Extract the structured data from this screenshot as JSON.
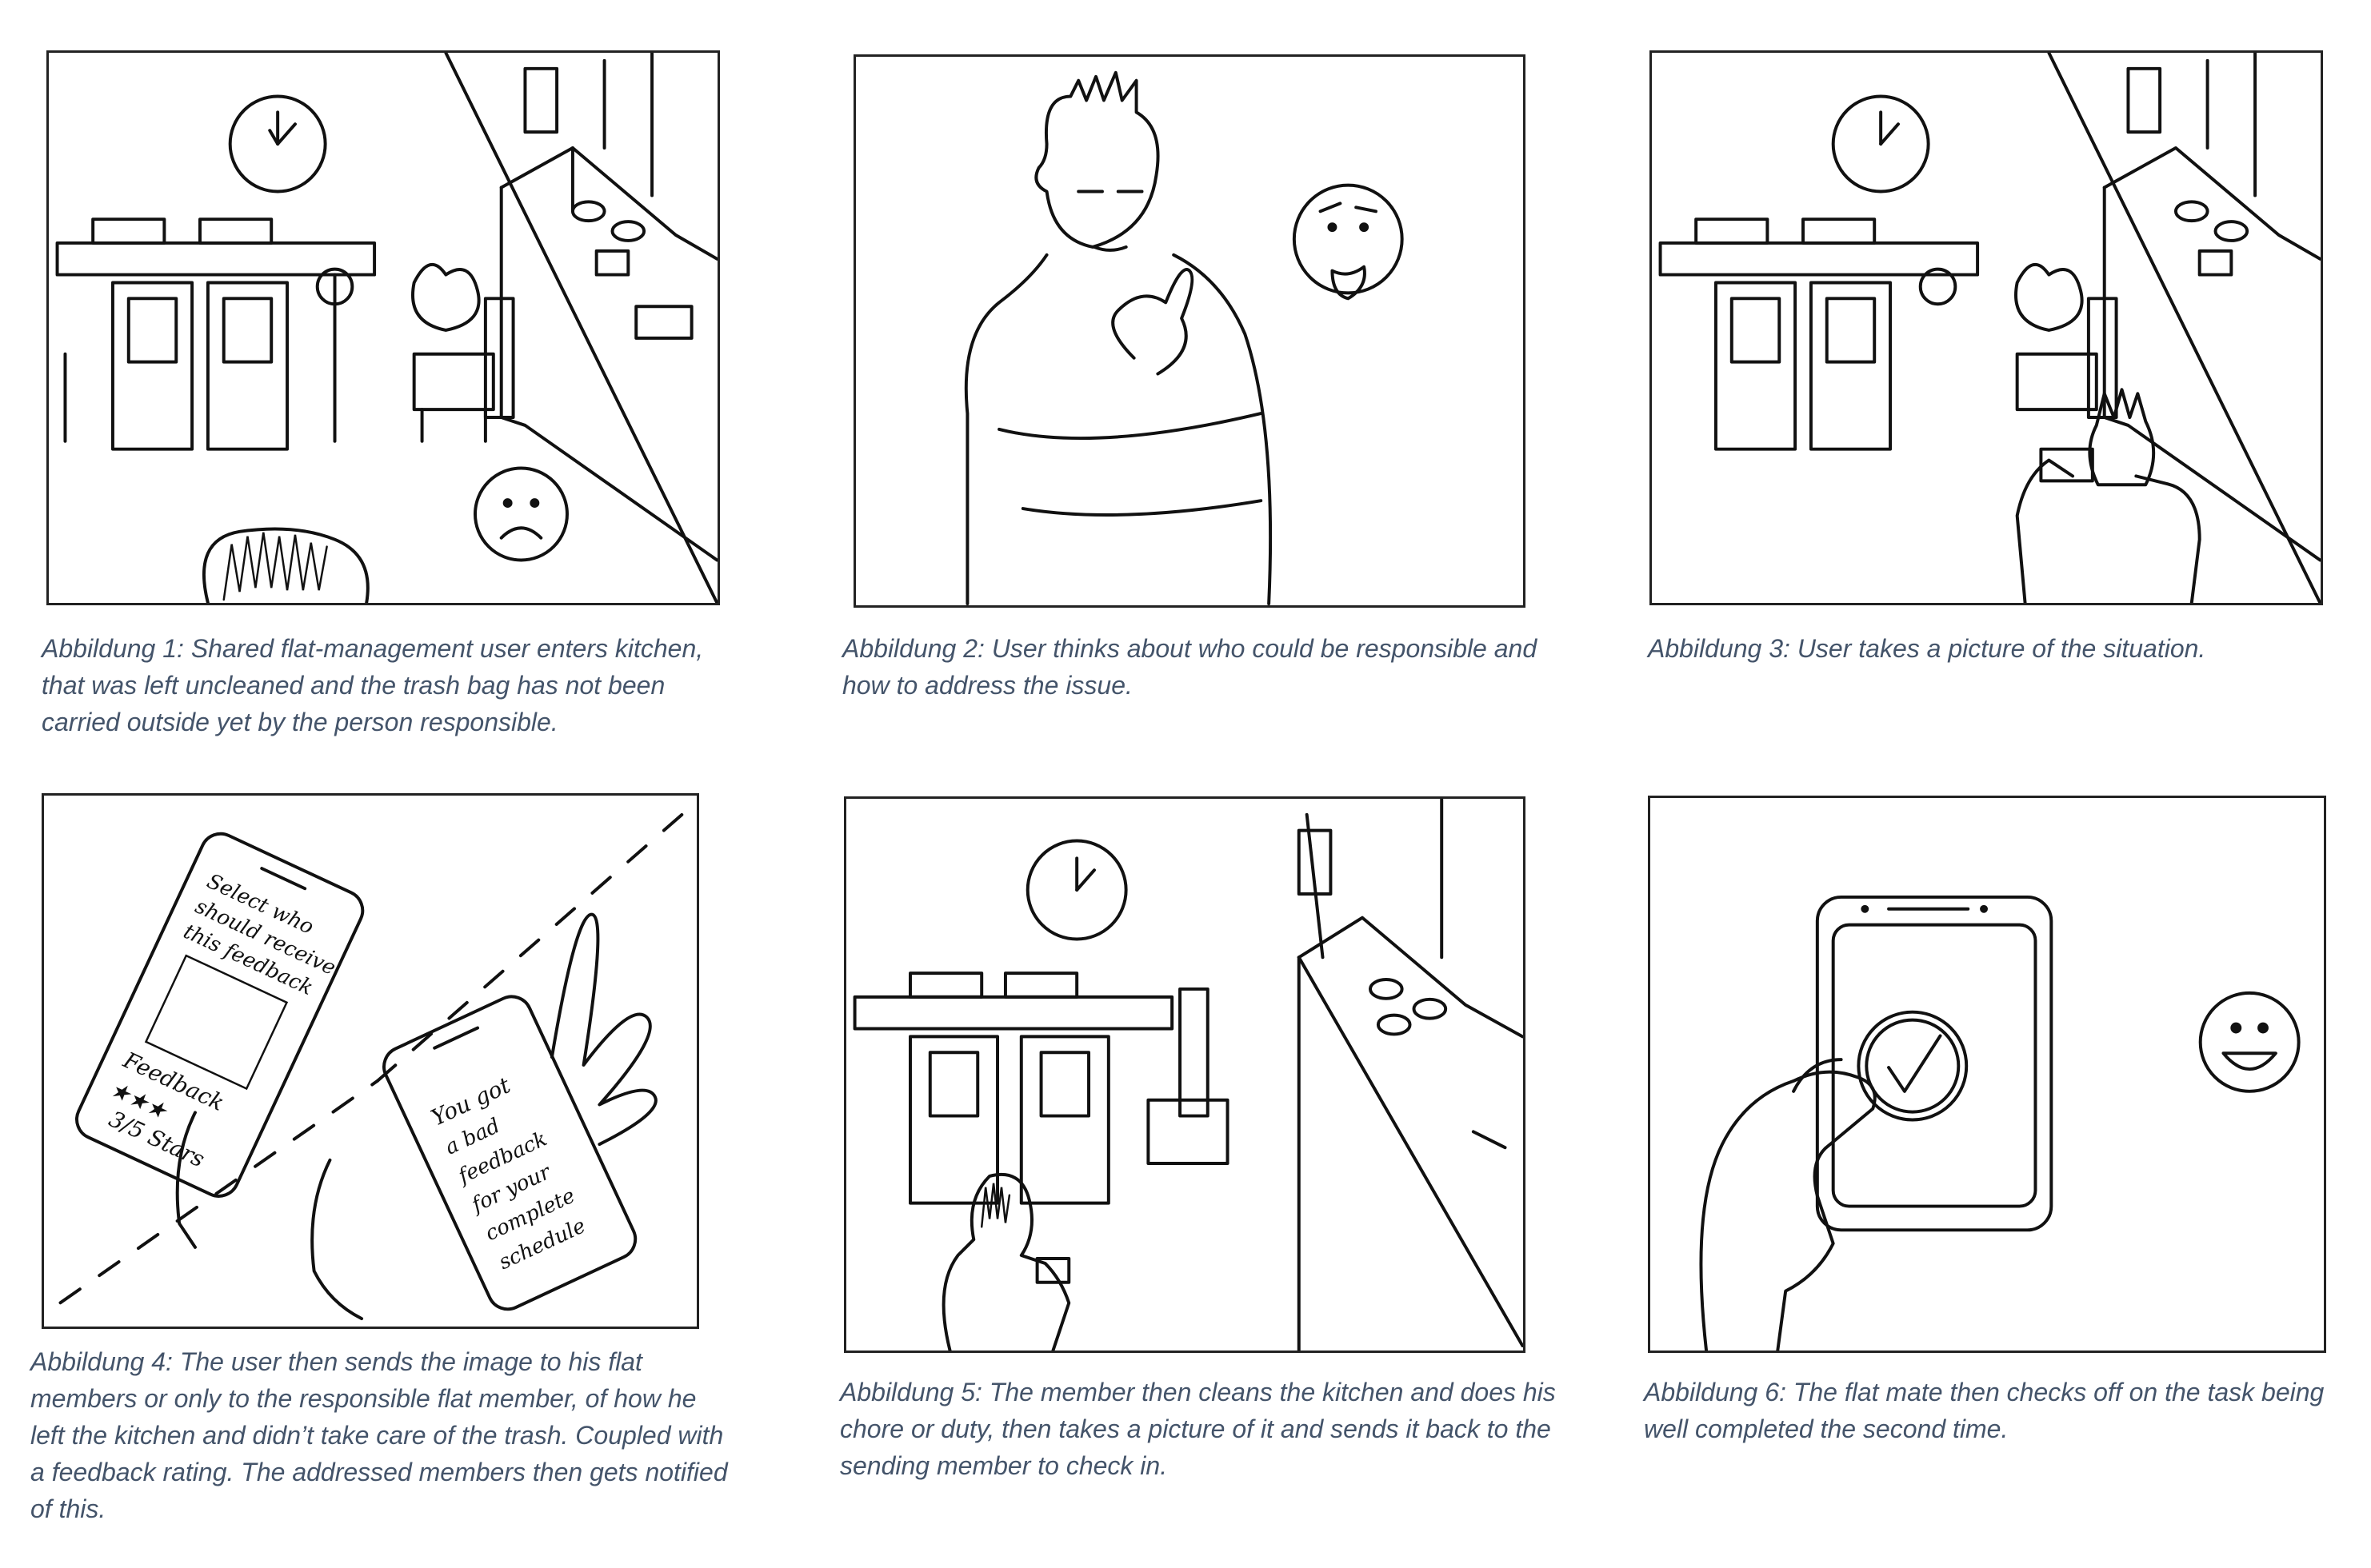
{
  "captions": [
    "Abbildung 1: Shared flat-management user enters kitchen, that was left uncleaned and the trash bag has not been carried outside yet by the person responsible.",
    "Abbildung 2: User thinks about who could be responsible and how to address the issue.",
    "Abbildung 3: User takes a picture of the situation.",
    "Abbildung 4: The user then sends the image to his flat members or only to the responsible flat member, of how he left the kitchen and didn’t take care of the trash. Coupled with a feedback rating. The addressed members then gets notified of this.",
    "Abbildung 5: The member then cleans the kitchen and does his chore or duty, then takes a picture of it and sends it back to the sending member to check in.",
    "Abbildung 6: The flat mate then checks off on the task being well completed the second time."
  ],
  "sketch_text": {
    "phone_a_line1": "Select who",
    "phone_a_line2": "should receive",
    "phone_a_line3": "this feedback",
    "phone_a_line4": "Feedback",
    "phone_a_line5": "3/5 Stars",
    "phone_b_line1": "You got",
    "phone_b_line2": "a bad",
    "phone_b_line3": "feedback",
    "phone_b_line4": "for your",
    "phone_b_line5": "complete",
    "phone_b_line6": "schedule"
  }
}
